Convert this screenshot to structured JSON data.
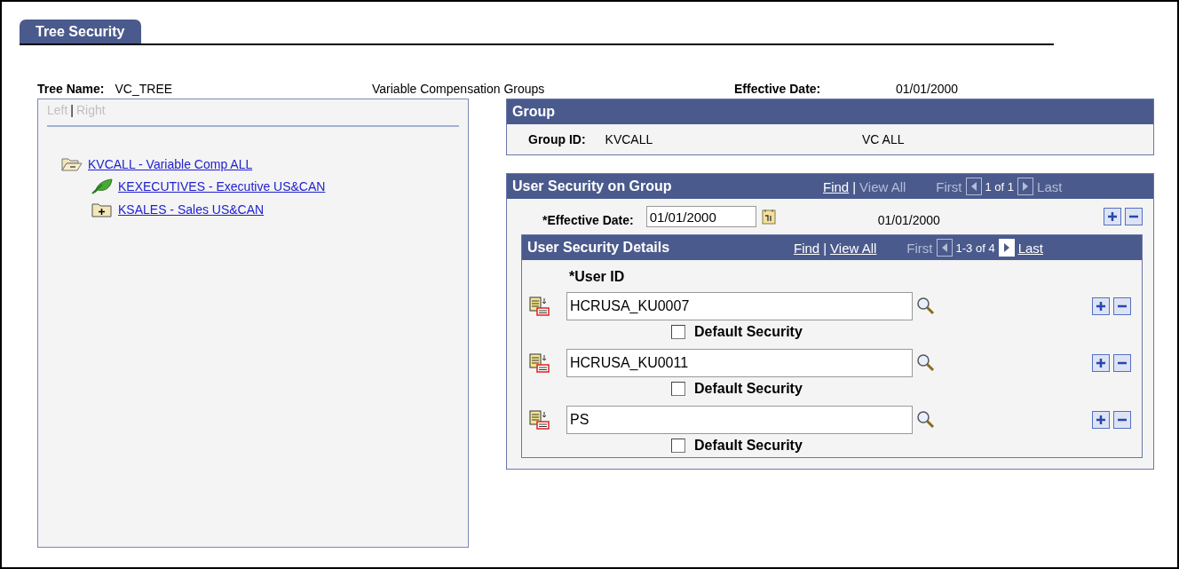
{
  "tabs": [
    {
      "label": "Tree Security",
      "selected": true
    }
  ],
  "header": {
    "tree_name_label": "Tree Name:",
    "tree_name": "VC_TREE",
    "description": "Variable Compensation Groups",
    "effective_date_label": "Effective Date:",
    "effective_date": "01/01/2000"
  },
  "tree_panel": {
    "view_links": [
      {
        "label": "Left",
        "disabled": true
      },
      {
        "label": "Right",
        "disabled": true
      }
    ],
    "separator": "|",
    "nodes": [
      {
        "label": "KVCALL - Variable Comp ALL",
        "kind": "open-folder",
        "children": [
          {
            "label": "KEXECUTIVES - Executive US&CAN",
            "kind": "leaf"
          },
          {
            "label": "KSALES - Sales US&CAN",
            "kind": "closed-folder"
          }
        ]
      }
    ]
  },
  "group": {
    "title": "Group",
    "group_id_label": "Group ID:",
    "group_id": "KVCALL",
    "group_name": "VC ALL"
  },
  "user_security": {
    "title": "User Security on Group",
    "nav": {
      "find": {
        "label": "Find",
        "disabled": false
      },
      "separator": "|",
      "view_all": {
        "label": "View All",
        "disabled": true
      },
      "first": {
        "label": "First",
        "disabled": true
      },
      "range": "1 of 1",
      "last": {
        "label": "Last",
        "disabled": true
      }
    },
    "effective_date_label": "*Effective Date:",
    "effective_date": "01/01/2000",
    "effective_date_display": "01/01/2000",
    "details": {
      "title": "User Security Details",
      "nav": {
        "find": {
          "label": "Find",
          "disabled": false
        },
        "separator": "|",
        "view_all": {
          "label": "View All",
          "disabled": false
        },
        "first": {
          "label": "First",
          "disabled": true
        },
        "range": "1-3 of 4",
        "last": {
          "label": "Last",
          "disabled": false
        }
      },
      "user_id_label": "*User ID",
      "rows": [
        {
          "user_id": "HCRUSA_KU0007",
          "checkbox_label": "Default Security",
          "checked": false
        },
        {
          "user_id": "HCRUSA_KU0011",
          "checkbox_label": "Default Security",
          "checked": false
        },
        {
          "user_id": "PS",
          "checkbox_label": "Default Security",
          "checked": false
        }
      ]
    }
  }
}
